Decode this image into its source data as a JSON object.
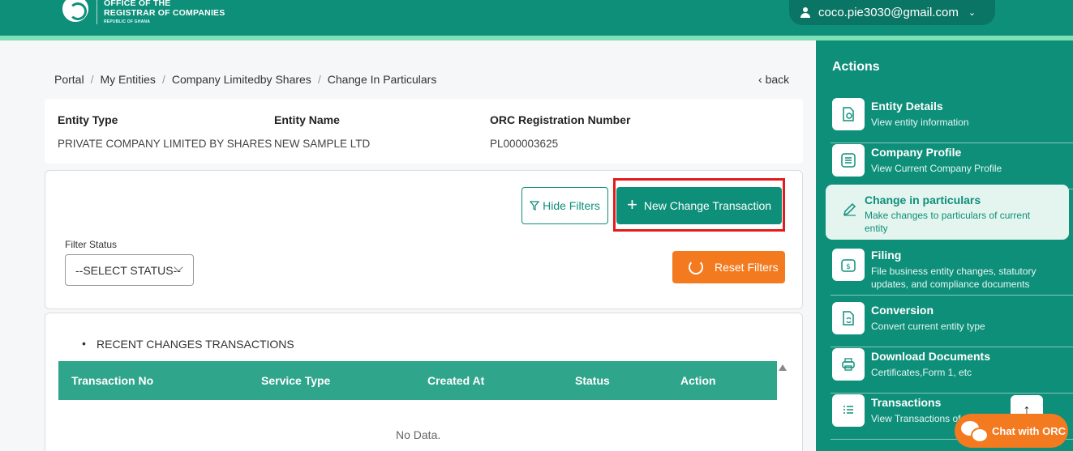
{
  "header": {
    "org_line1": "OFFICE OF THE",
    "org_line2": "REGISTRAR OF COMPANIES",
    "org_sub": "REPUBLIC OF GHANA",
    "user_email": "coco.pie3030@gmail.com"
  },
  "breadcrumb": {
    "items": [
      "Portal",
      "My Entities",
      "Company Limitedby Shares",
      "Change In Particulars"
    ],
    "separator": "/",
    "back_label": "back"
  },
  "entity": {
    "type_label": "Entity Type",
    "type_value": "PRIVATE COMPANY LIMITED BY SHARES",
    "name_label": "Entity Name",
    "name_value": "NEW SAMPLE LTD",
    "reg_label": "ORC Registration Number",
    "reg_value": "PL000003625"
  },
  "filters": {
    "hide_label": "Hide Filters",
    "new_label": "New Change Transaction",
    "status_label": "Filter Status",
    "status_value": "--SELECT STATUS--",
    "reset_label": "Reset Filters"
  },
  "transactions": {
    "title": "RECENT CHANGES TRANSACTIONS",
    "columns": [
      "Transaction No",
      "Service Type",
      "Created At",
      "Status",
      "Action"
    ],
    "empty_text": "No Data."
  },
  "sidebar": {
    "title": "Actions",
    "items": [
      {
        "title": "Entity Details",
        "desc": "View entity information",
        "icon": "document-search-icon"
      },
      {
        "title": "Company Profile",
        "desc": "View Current Company Profile",
        "icon": "list-icon"
      },
      {
        "title": "Change in particulars",
        "desc": "Make changes to particulars of current entity",
        "icon": "pencil-icon"
      },
      {
        "title": "Filing",
        "desc": "File business entity changes, statutory updates, and compliance documents",
        "icon": "money-icon"
      },
      {
        "title": "Conversion",
        "desc": "Convert current entity type",
        "icon": "convert-icon"
      },
      {
        "title": "Download Documents",
        "desc": "Certificates,Form 1, etc",
        "icon": "printer-icon"
      },
      {
        "title": "Transactions",
        "desc": "View Transactions of",
        "icon": "list-lines-icon"
      }
    ]
  },
  "chat": {
    "label": "Chat with ORC"
  },
  "colors": {
    "primary": "#0e8f7a",
    "accent": "#f47a20",
    "highlight": "#e31b1b"
  }
}
